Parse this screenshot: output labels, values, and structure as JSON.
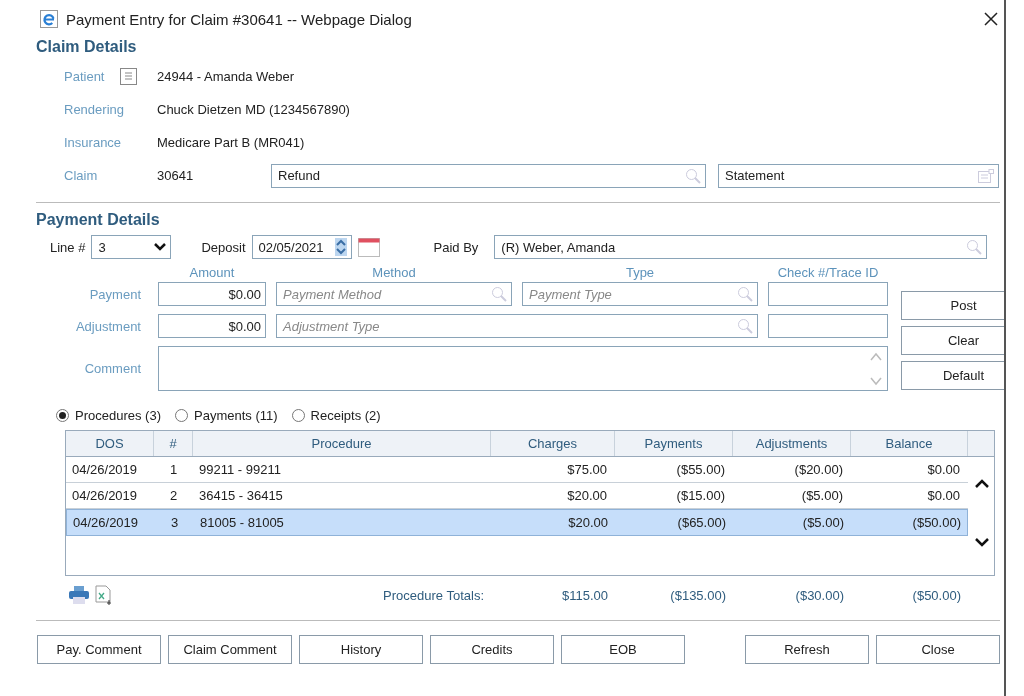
{
  "window": {
    "title": "Payment Entry for Claim #30641 -- Webpage Dialog"
  },
  "claim_details": {
    "heading": "Claim Details",
    "patient": {
      "label": "Patient",
      "value": "24944 - Amanda Weber"
    },
    "rendering": {
      "label": "Rendering",
      "value": "Chuck Dietzen MD (1234567890)"
    },
    "insurance": {
      "label": "Insurance",
      "value": "Medicare Part B (MR041)"
    },
    "claim": {
      "label": "Claim",
      "value": "30641"
    },
    "refund_field": {
      "value": "Refund"
    },
    "statement_field": {
      "value": "Statement"
    }
  },
  "payment_details": {
    "heading": "Payment Details",
    "line": {
      "label": "Line #",
      "value": "3"
    },
    "deposit": {
      "label": "Deposit",
      "value": "02/05/2021"
    },
    "paid_by": {
      "label": "Paid By",
      "value": "(R) Weber, Amanda"
    },
    "column_headers": [
      "Amount",
      "Method",
      "Type",
      "Check #/Trace ID"
    ],
    "payment": {
      "label": "Payment",
      "amount": "$0.00",
      "method": {
        "placeholder": "Payment Method"
      },
      "type": {
        "placeholder": "Payment Type"
      }
    },
    "adjustment": {
      "label": "Adjustment",
      "amount": "$0.00",
      "type": {
        "placeholder": "Adjustment Type"
      }
    },
    "comment": {
      "label": "Comment"
    },
    "action_buttons": [
      "Post",
      "Clear",
      "Default"
    ]
  },
  "view_options": [
    {
      "label": "Procedures (3)",
      "selected": true
    },
    {
      "label": "Payments (11)",
      "selected": false
    },
    {
      "label": "Receipts (2)",
      "selected": false
    }
  ],
  "table": {
    "columns": [
      "DOS",
      "#",
      "Procedure",
      "Charges",
      "Payments",
      "Adjustments",
      "Balance"
    ],
    "rows": [
      {
        "dos": "04/26/2019",
        "num": "1",
        "procedure": "99211 - 99211",
        "charges": "$75.00",
        "payments": "($55.00)",
        "adjustments": "($20.00)",
        "balance": "$0.00",
        "selected": false
      },
      {
        "dos": "04/26/2019",
        "num": "2",
        "procedure": "36415 - 36415",
        "charges": "$20.00",
        "payments": "($15.00)",
        "adjustments": "($5.00)",
        "balance": "$0.00",
        "selected": false
      },
      {
        "dos": "04/26/2019",
        "num": "3",
        "procedure": "81005 - 81005",
        "charges": "$20.00",
        "payments": "($65.00)",
        "adjustments": "($5.00)",
        "balance": "($50.00)",
        "selected": true
      }
    ],
    "totals": {
      "label": "Procedure Totals:",
      "charges": "$115.00",
      "payments": "($135.00)",
      "adjustments": "($30.00)",
      "balance": "($50.00)"
    }
  },
  "buttons": [
    "Pay. Comment",
    "Claim Comment",
    "History",
    "Credits",
    "EOB",
    "Refresh",
    "Close"
  ]
}
